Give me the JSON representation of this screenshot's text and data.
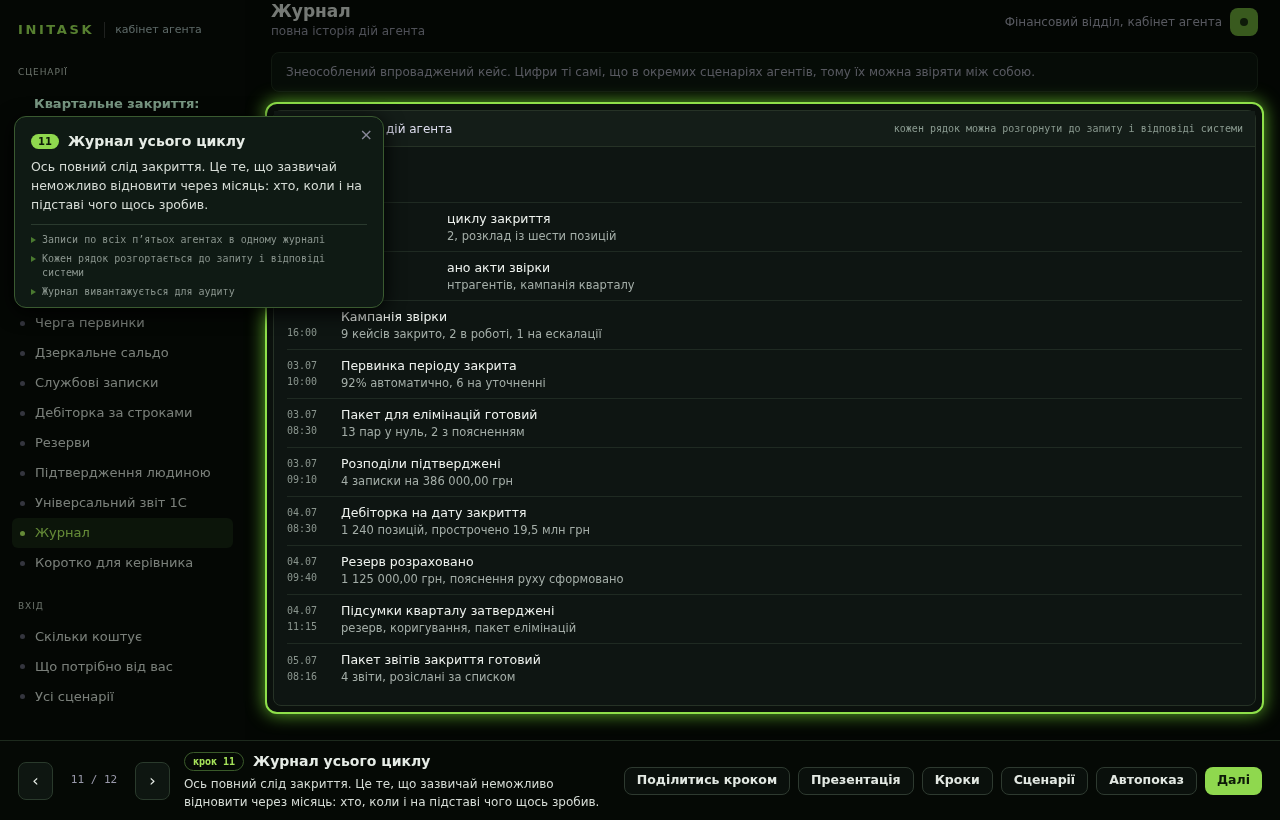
{
  "brand": {
    "logo": "INITASK",
    "subtitle": "кабінет агента"
  },
  "sidebar": {
    "sections": [
      {
        "title": "СЦЕНАРІЇ",
        "group": "Квартальне закриття:",
        "items": [
          {
            "label": "Черга первинки",
            "selected": false
          },
          {
            "label": "Дзеркальне сальдо",
            "selected": false
          },
          {
            "label": "Службові записки",
            "selected": false
          },
          {
            "label": "Дебіторка за строками",
            "selected": false
          },
          {
            "label": "Резерви",
            "selected": false
          },
          {
            "label": "Підтвердження людиною",
            "selected": false
          },
          {
            "label": "Універсальний звіт 1С",
            "selected": false
          },
          {
            "label": "Журнал",
            "selected": true
          },
          {
            "label": "Коротко для керівника",
            "selected": false
          }
        ]
      },
      {
        "title": "ВХІД",
        "items": [
          {
            "label": "Скільки коштує",
            "selected": false
          },
          {
            "label": "Що потрібно від вас",
            "selected": false
          },
          {
            "label": "Усі сценарії",
            "selected": false
          }
        ]
      }
    ]
  },
  "header": {
    "title": "Журнал",
    "subtitle": "повна історія дій агента",
    "account": "Фінансовий відділ, кабінет агента"
  },
  "notice": "Знеособлений впроваджений кейс. Цифри ті самі, що в окремих сценаріях агентів, тому їх можна звіряти між собою.",
  "log": {
    "title": "дій агента",
    "hint": "кожен рядок можна розгорнути до запиту і відповіді системи",
    "rows": [
      {
        "title": "циклу закриття",
        "detail": "2, розклад із шести позицій"
      },
      {
        "title": "ано акти звірки",
        "detail": "нтрагентів, кампанія кварталу"
      },
      {
        "time": "16:00",
        "title": "Кампанія звірки",
        "detail": "9 кейсів закрито, 2 в роботі, 1 на ескалації"
      },
      {
        "date": "03.07",
        "time": "10:00",
        "title": "Первинка періоду закрита",
        "detail": "92% автоматично, 6 на уточненні"
      },
      {
        "date": "03.07",
        "time": "08:30",
        "title": "Пакет для елімінацій готовий",
        "detail": "13 пар у нуль, 2 з поясненням"
      },
      {
        "date": "03.07",
        "time": "09:10",
        "title": "Розподіли підтверджені",
        "detail": "4 записки на 386 000,00 грн"
      },
      {
        "date": "04.07",
        "time": "08:30",
        "title": "Дебіторка на дату закриття",
        "detail": "1 240 позицій, прострочено 19,5 млн грн"
      },
      {
        "date": "04.07",
        "time": "09:40",
        "title": "Резерв розраховано",
        "detail": "1 125 000,00 грн, пояснення руху сформовано"
      },
      {
        "date": "04.07",
        "time": "11:15",
        "title": "Підсумки кварталу затверджені",
        "detail": "резерв, коригування, пакет елімінацій"
      },
      {
        "date": "05.07",
        "time": "08:16",
        "title": "Пакет звітів закриття готовий",
        "detail": "4 звіти, розіслані за списком"
      }
    ]
  },
  "tooltip": {
    "step": "11",
    "title": "Журнал усього циклу",
    "close": "×",
    "text": "Ось повний слід закриття. Це те, що зазвичай неможливо відновити через місяць: хто, коли і на підставі чого щось зробив.",
    "points": [
      "Записи по всіх п’ятьох агентах в одному журналі",
      "Кожен рядок розгортається до запиту і відповіді системи",
      "Журнал вивантажується для аудиту"
    ]
  },
  "tour": {
    "prev": "‹",
    "counter": "11 / 12",
    "next": "›",
    "badge": "крок 11",
    "title": "Журнал усього циклу",
    "text": "Ось повний слід закриття. Це те, що зазвичай неможливо відновити через місяць: хто, коли і на підставі чого щось зробив.",
    "buttons": [
      {
        "label": "Поділитись кроком",
        "kind": "secondary"
      },
      {
        "label": "Презентація",
        "kind": "secondary"
      },
      {
        "label": "Кроки",
        "kind": "secondary"
      },
      {
        "label": "Сценарії",
        "kind": "secondary"
      },
      {
        "label": "Автопоказ",
        "kind": "secondary"
      },
      {
        "label": "Далі",
        "kind": "primary"
      }
    ]
  }
}
